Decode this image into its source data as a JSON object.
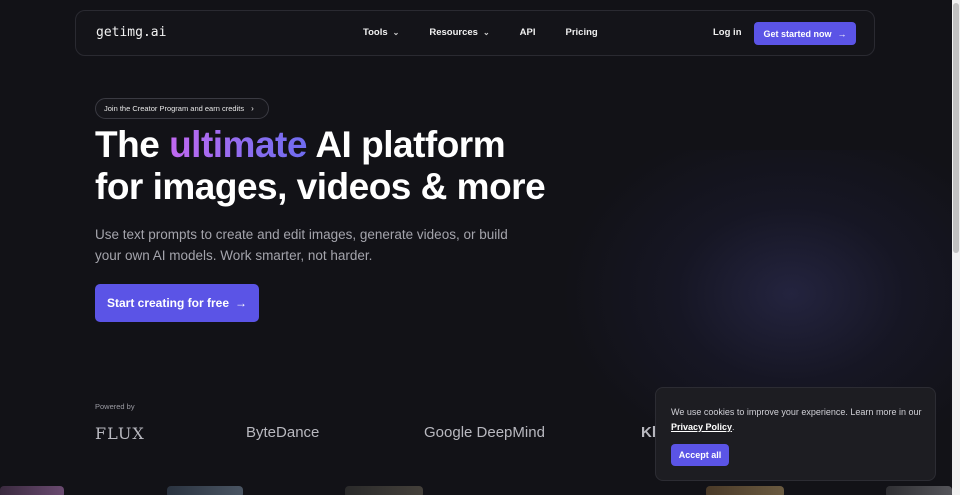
{
  "header": {
    "logo": "getimg.ai",
    "nav": [
      {
        "label": "Tools",
        "dropdown": true
      },
      {
        "label": "Resources",
        "dropdown": true
      },
      {
        "label": "API",
        "dropdown": false
      },
      {
        "label": "Pricing",
        "dropdown": false
      }
    ],
    "login_label": "Log in",
    "cta_label": "Get started now"
  },
  "hero": {
    "pill_label": "Join the Creator Program and earn credits",
    "headline_part1": "The ",
    "headline_accent": "ultimate",
    "headline_part2": " AI platform",
    "headline_line2": "for images, videos & more",
    "subtext": "Use text prompts to create and edit images, generate videos, or build your own AI models. Work smarter, not harder.",
    "cta_label": "Start creating for free"
  },
  "powered_by": {
    "label": "Powered by",
    "brands": [
      "FLUX",
      "ByteDance",
      "Google DeepMind",
      "Kl"
    ]
  },
  "cookie_banner": {
    "text": "We use cookies to improve your experience. Learn more in our ",
    "link_label": "Privacy Policy",
    "text_end": ".",
    "accept_label": "Accept all"
  },
  "colors": {
    "background": "#121217",
    "accent": "#5b54e6",
    "gradient_start": "#c168f0",
    "gradient_end": "#6f6cf0"
  },
  "icons": {
    "chevron": "chevron-down-icon",
    "arrow": "arrow-right-icon",
    "pill_chevron": "chevron-right-icon"
  }
}
